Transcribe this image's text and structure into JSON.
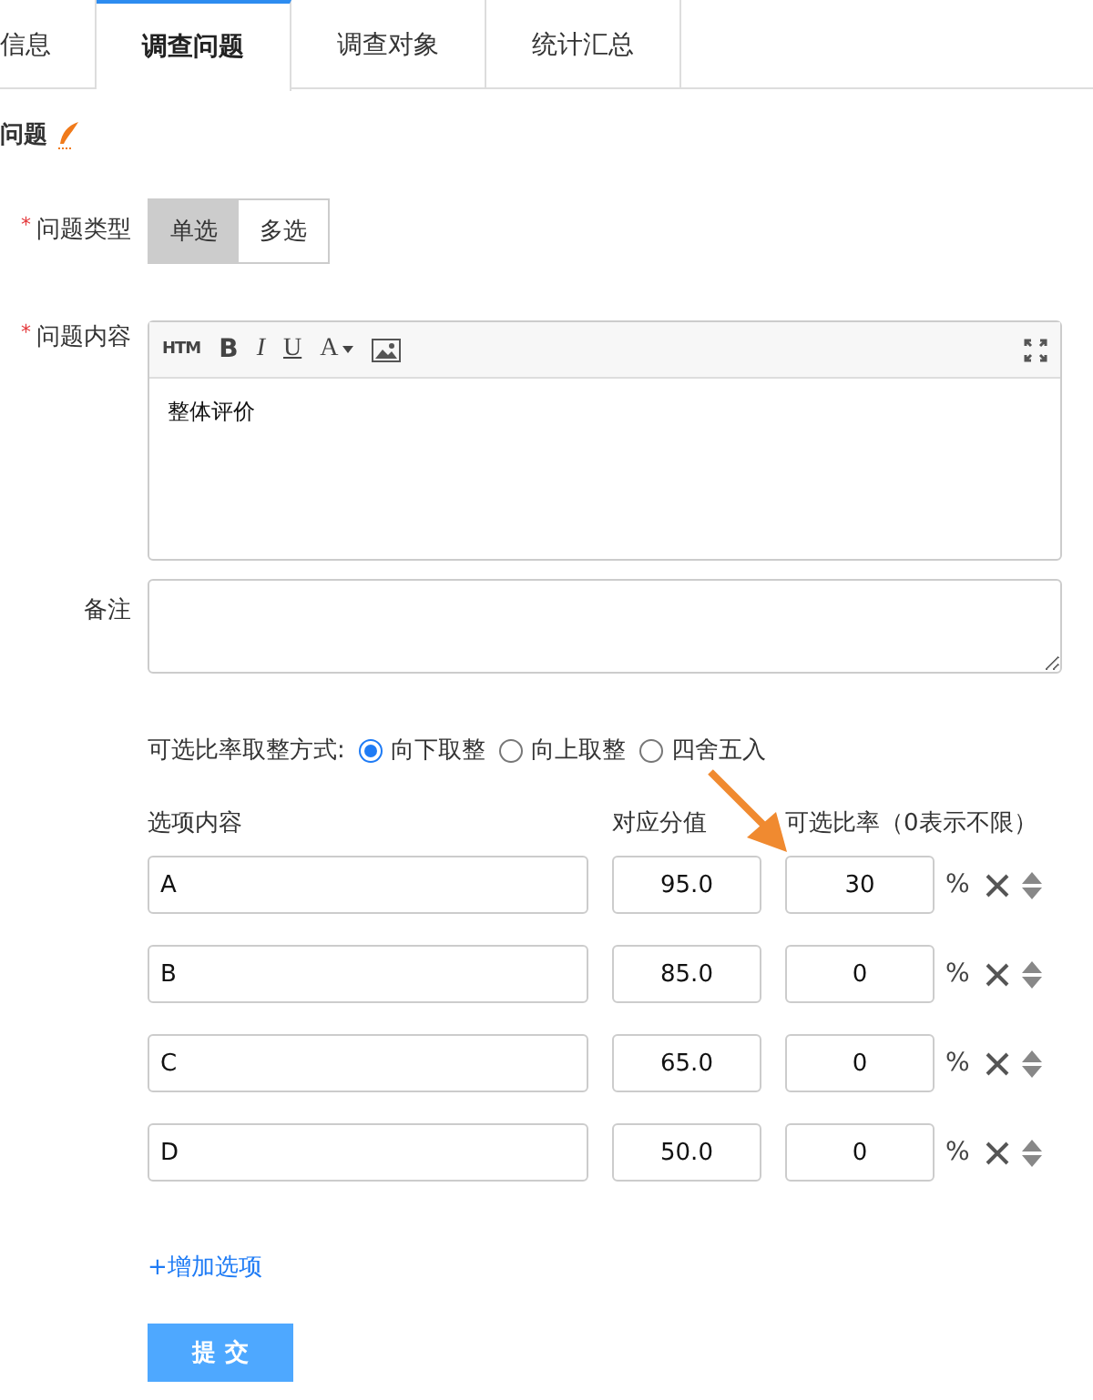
{
  "tabs": [
    {
      "label": "信息",
      "selected": false
    },
    {
      "label": "调查问题",
      "selected": true
    },
    {
      "label": "调查对象",
      "selected": false
    },
    {
      "label": "统计汇总",
      "selected": false
    }
  ],
  "section_title": "问题",
  "question_type": {
    "mark": "*",
    "label": "问题类型",
    "options": [
      {
        "label": "单选",
        "selected": true
      },
      {
        "label": "多选",
        "selected": false
      }
    ]
  },
  "question_content": {
    "mark": "*",
    "label": "问题内容",
    "toolbar": [
      {
        "kind": "text",
        "label": "HTM"
      },
      {
        "kind": "bold",
        "label": "B"
      },
      {
        "kind": "italic",
        "label": "I"
      },
      {
        "kind": "underline",
        "label": "U"
      },
      {
        "kind": "color",
        "label": "A"
      },
      {
        "kind": "image"
      },
      {
        "kind": "fullscreen"
      }
    ],
    "value": "整体评价"
  },
  "remark": {
    "label": "备注"
  },
  "rounding": {
    "label": "可选比率取整方式:",
    "options": [
      {
        "label": "向下取整",
        "selected": true
      },
      {
        "label": "向上取整",
        "selected": false
      },
      {
        "label": "四舍五入",
        "selected": false
      }
    ]
  },
  "options_table": {
    "columns": [
      "选项内容",
      "对应分值",
      "可选比率（0表示不限）"
    ],
    "rows": [
      {
        "content": "A",
        "score": "95.0",
        "rate": "30",
        "unit": "%"
      },
      {
        "content": "B",
        "score": "85.0",
        "rate": "0",
        "unit": "%"
      },
      {
        "content": "C",
        "score": "65.0",
        "rate": "0",
        "unit": "%"
      },
      {
        "content": "D",
        "score": "50.0",
        "rate": "0",
        "unit": "%"
      }
    ]
  },
  "add_option": "+增加选项",
  "submit": "提 交"
}
